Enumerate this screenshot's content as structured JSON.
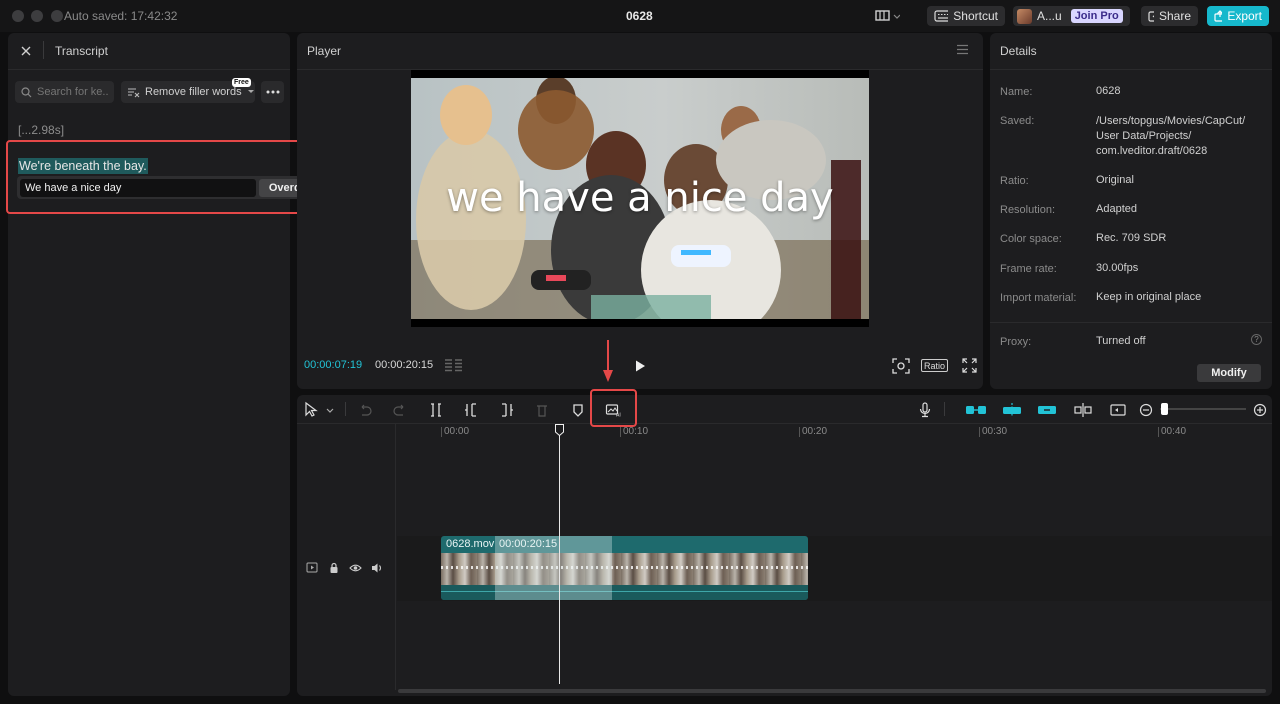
{
  "titlebar": {
    "autosave": "Auto saved: 17:42:32",
    "title": "0628",
    "shortcut": "Shortcut",
    "user": "A...u",
    "join_pro": "Join Pro",
    "share": "Share",
    "export": "Export"
  },
  "transcript": {
    "title": "Transcript",
    "search_placeholder": "Search for ke...",
    "remove_filler": "Remove filler words",
    "free_badge": "Free",
    "silence": "[...2.98s]",
    "sentence": "We're beneath the bay.",
    "edit_value": "We have a nice day",
    "overdub": "Overdub"
  },
  "player": {
    "title": "Player",
    "caption": "we have a nice day",
    "current_time": "00:00:07:19",
    "total_time": "00:00:20:15",
    "ratio": "Ratio"
  },
  "details": {
    "title": "Details",
    "rows": [
      {
        "label": "Name:",
        "value": "0628"
      },
      {
        "label": "Saved:",
        "value": "/Users/topgus/Movies/CapCut/ User Data/Projects/ com.lveditor.draft/0628"
      },
      {
        "label": "Ratio:",
        "value": "Original"
      },
      {
        "label": "Resolution:",
        "value": "Adapted"
      },
      {
        "label": "Color space:",
        "value": "Rec. 709 SDR"
      },
      {
        "label": "Frame rate:",
        "value": "30.00fps"
      },
      {
        "label": "Import material:",
        "value": "Keep in original place"
      },
      {
        "label": "Proxy:",
        "value": "Turned off"
      }
    ],
    "modify": "Modify"
  },
  "timeline": {
    "ticks": [
      "00:00",
      "00:10",
      "00:20",
      "00:30",
      "00:40"
    ],
    "clip_name": "0628.mov",
    "clip_duration": "00:00:20:15"
  },
  "colors": {
    "accent": "#22c3d6",
    "highlight": "#1f5a5c",
    "clip": "#1e6a6d",
    "annotation": "#e54848"
  }
}
